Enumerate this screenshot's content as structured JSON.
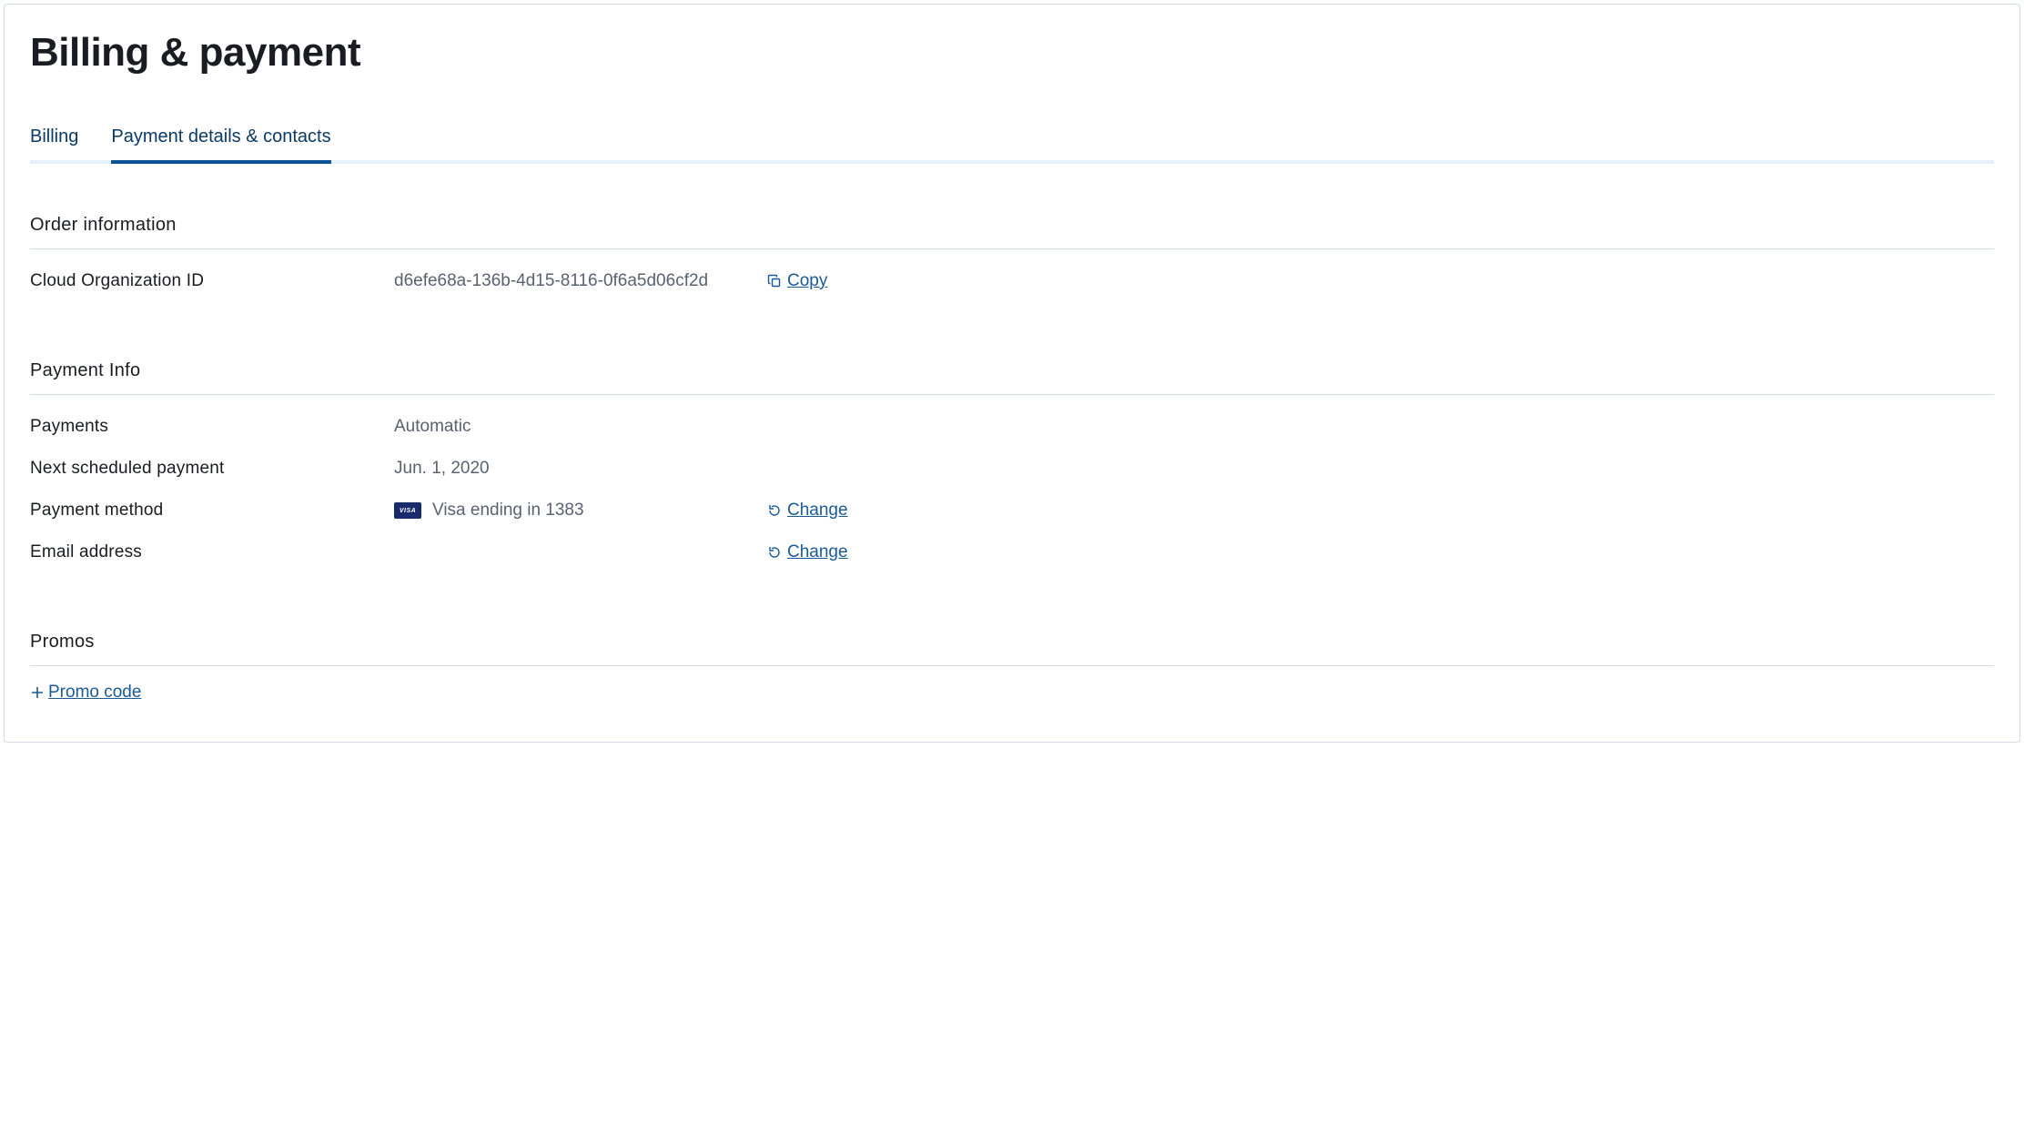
{
  "page": {
    "title": "Billing & payment"
  },
  "tabs": [
    {
      "label": "Billing",
      "active": false
    },
    {
      "label": "Payment details & contacts",
      "active": true
    }
  ],
  "sections": {
    "order_info": {
      "heading": "Order information",
      "org_id_label": "Cloud Organization ID",
      "org_id_value": "d6efe68a-136b-4d15-8116-0f6a5d06cf2d",
      "copy_label": "Copy"
    },
    "payment_info": {
      "heading": "Payment Info",
      "payments_label": "Payments",
      "payments_value": "Automatic",
      "next_payment_label": "Next scheduled payment",
      "next_payment_value": "Jun. 1, 2020",
      "payment_method_label": "Payment method",
      "payment_method_value": "Visa ending in 1383",
      "card_brand": "VISA",
      "change_label": "Change",
      "email_label": "Email address",
      "email_value": ""
    },
    "promos": {
      "heading": "Promos",
      "promo_code_label": "Promo code"
    }
  }
}
